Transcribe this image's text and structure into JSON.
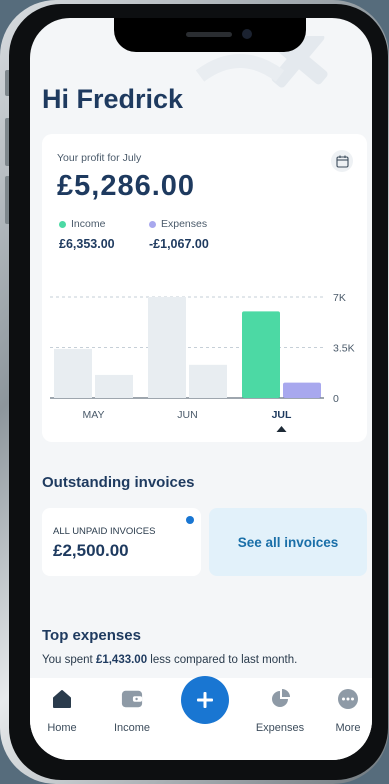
{
  "header": {
    "greeting": "Hi Fredrick"
  },
  "profit": {
    "label": "Your profit for July",
    "value": "£5,286.00",
    "calendar_icon": "calendar-icon"
  },
  "legend": {
    "income": {
      "label": "Income",
      "value": "£6,353.00",
      "color": "#4cd9a4"
    },
    "expenses": {
      "label": "Expenses",
      "value": "-£1,067.00",
      "color": "#a8a8ee"
    }
  },
  "chart_data": {
    "type": "bar",
    "categories": [
      "MAY",
      "JUN",
      "JUL"
    ],
    "selected_category": "JUL",
    "series": [
      {
        "name": "Income",
        "values": [
          3400,
          7000,
          6000
        ]
      },
      {
        "name": "Expenses",
        "values": [
          1600,
          2300,
          1067
        ]
      }
    ],
    "y_ticks": [
      "0",
      "3.5K",
      "7K"
    ],
    "ylim": [
      0,
      7000
    ],
    "grid": true,
    "inactive_color": "#e8edf1",
    "income_color": "#4cd9a4",
    "expenses_color": "#a8a8ee"
  },
  "invoices": {
    "title": "Outstanding invoices",
    "unpaid_label": "ALL UNPAID INVOICES",
    "unpaid_value": "£2,500.00",
    "see_all_label": "See all invoices"
  },
  "top_expenses": {
    "title": "Top expenses",
    "text_before": "You spent ",
    "amount": "£1,433.00",
    "text_after": " less compared to last month."
  },
  "tabbar": {
    "items": [
      {
        "label": "Home",
        "icon": "home-icon"
      },
      {
        "label": "Income",
        "icon": "wallet-icon"
      },
      {
        "label": "",
        "icon": "plus-icon"
      },
      {
        "label": "Expenses",
        "icon": "pie-chart-icon"
      },
      {
        "label": "More",
        "icon": "more-icon"
      }
    ],
    "accent": "#1976d2"
  }
}
